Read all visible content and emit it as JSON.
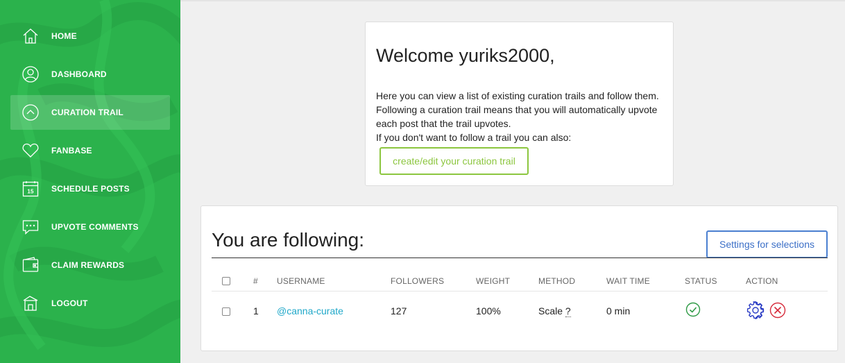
{
  "sidebar": {
    "items": [
      {
        "label": "HOME",
        "icon": "home-icon"
      },
      {
        "label": "DASHBOARD",
        "icon": "user-circle-icon"
      },
      {
        "label": "CURATION TRAIL",
        "icon": "chevron-up-circle-icon",
        "active": true
      },
      {
        "label": "FANBASE",
        "icon": "heart-icon"
      },
      {
        "label": "SCHEDULE POSTS",
        "icon": "calendar-icon",
        "calendar_day": "15"
      },
      {
        "label": "UPVOTE COMMENTS",
        "icon": "comment-icon"
      },
      {
        "label": "CLAIM REWARDS",
        "icon": "wallet-icon"
      },
      {
        "label": "LOGOUT",
        "icon": "logout-icon"
      }
    ],
    "color": "#2bb24c"
  },
  "welcome": {
    "title": "Welcome yuriks2000,",
    "line1": "Here you can view a list of existing curation trails and follow them.",
    "line2": "Following a curation trail means that you will automatically upvote",
    "line3": "each post that the trail upvotes.",
    "line4": "If you don't want to follow a trail you can also:",
    "create_button": "create/edit your curation trail"
  },
  "following": {
    "title": "You are following:",
    "settings_button": "Settings for selections",
    "columns": [
      "#",
      "USERNAME",
      "FOLLOWERS",
      "WEIGHT",
      "METHOD",
      "WAIT TIME",
      "STATUS",
      "ACTION"
    ],
    "rows": [
      {
        "num": "1",
        "username": "@canna-curate",
        "followers": "127",
        "weight": "100%",
        "method": "Scale",
        "method_help": "?",
        "wait_time": "0 min",
        "status": "active",
        "status_icon": "check-circle-icon"
      }
    ],
    "accent_blue": "#3b6fc7",
    "accent_green": "#8cc63f",
    "link_color": "#20a8c9"
  }
}
